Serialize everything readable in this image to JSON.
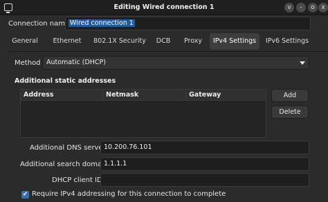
{
  "window": {
    "title": "Editing Wired connection 1",
    "app_icon": "monitor-icon",
    "controls": [
      "v",
      "-",
      "o",
      "x"
    ]
  },
  "connection": {
    "label": "Connection name",
    "value": "Wired connection 1"
  },
  "tabs": [
    {
      "label": "General"
    },
    {
      "label": "Ethernet"
    },
    {
      "label": "802.1X Security"
    },
    {
      "label": "DCB"
    },
    {
      "label": "Proxy"
    },
    {
      "label": "IPv4 Settings",
      "active": true
    },
    {
      "label": "IPv6 Settings"
    }
  ],
  "ipv4": {
    "method_label": "Method",
    "method_value": "Automatic (DHCP)",
    "static_title": "Additional static addresses",
    "columns": [
      "Address",
      "Netmask",
      "Gateway"
    ],
    "rows": [],
    "add_label": "Add",
    "delete_label": "Delete",
    "dns_label": "Additional DNS servers",
    "dns_value": "10.200.76.101",
    "search_label": "Additional search domains",
    "search_value": "1.1.1.1",
    "dhcp_label": "DHCP client ID",
    "dhcp_value": "",
    "require_label": "Require IPv4 addressing for this connection to complete",
    "require_checked": true
  }
}
